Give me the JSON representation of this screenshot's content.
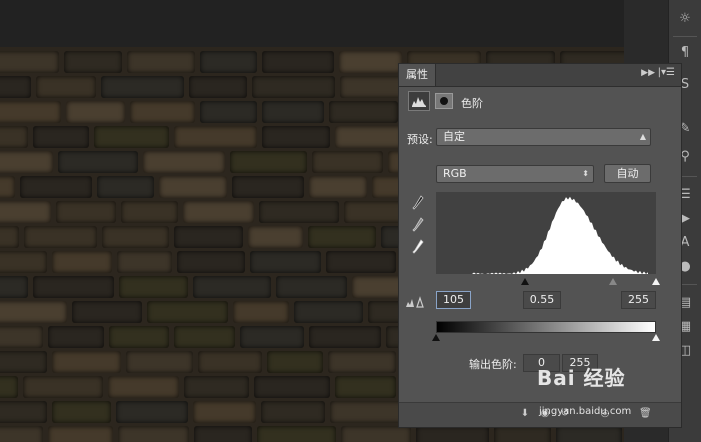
{
  "panel": {
    "tab_label": "属性",
    "title": "色阶",
    "collapse_icon": "double-chevron-right-icon",
    "menu_icon": "panel-menu-icon",
    "adjustment_icon": "levels-histogram-icon",
    "mask_icon": "layer-mask-icon"
  },
  "preset": {
    "label": "预设:",
    "value": "自定"
  },
  "channel": {
    "value": "RGB"
  },
  "auto_button": "自动",
  "input_levels": {
    "black": "105",
    "gamma": "0.55",
    "white": "255"
  },
  "output_levels": {
    "label": "输出色阶:",
    "black": "0",
    "white": "255"
  },
  "watermark": {
    "text": "Bai 经验",
    "sub": "jingyan.baidu.com"
  },
  "colors": {
    "panel_bg": "#535353",
    "histogram_bg": "#414141",
    "input_focus": "#8aa4c8"
  }
}
